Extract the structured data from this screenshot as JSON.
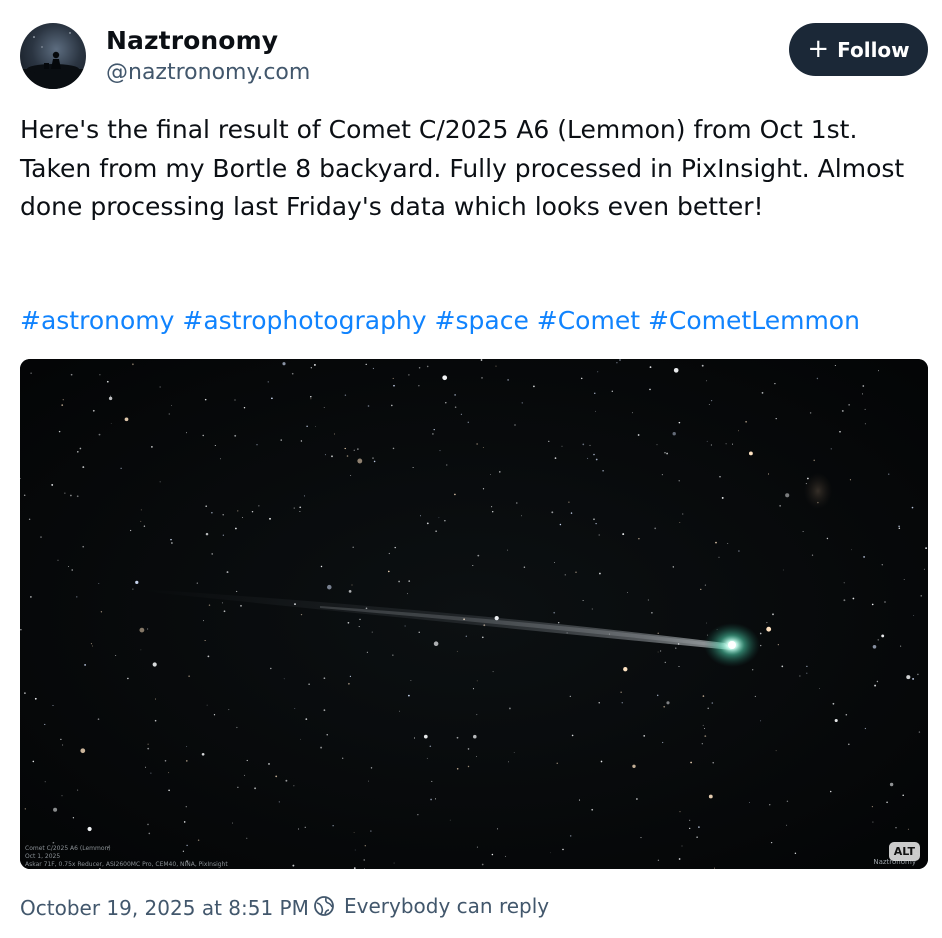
{
  "author": {
    "display_name": "Naztronomy",
    "handle": "@naztronomy.com",
    "avatar_icon": "avatar-silhouette"
  },
  "follow_button": {
    "icon": "plus-icon",
    "plus": "+",
    "label": "Follow"
  },
  "post": {
    "text": "Here's the final result of Comet C/2025 A6 (Lemmon) from Oct 1st. Taken from my Bortle 8 backyard. Fully processed in PixInsight. Almost done processing last Friday's data which looks even better!",
    "hashtags": [
      "#astronomy",
      "#astrophotography",
      "#space",
      "#Comet",
      "#CometLemmon"
    ]
  },
  "image": {
    "caption_lines": [
      "Comet C/2025 A6 (Lemmon)",
      "Oct 1, 2025",
      "Askar 71F, 0.75x Reducer, ASI2600MC Pro, CEM40, NINA, PixInsight"
    ],
    "watermark": "Naztronomy",
    "alt_badge": "ALT"
  },
  "footer": {
    "timestamp": "October 19, 2025 at 8:51 PM",
    "reply_setting": "Everybody can reply",
    "reply_icon": "globe-icon"
  },
  "colors": {
    "link": "#1083fe",
    "follow_bg": "#1b2837",
    "muted": "#42576c",
    "comet_head": "#7fe0c4"
  }
}
